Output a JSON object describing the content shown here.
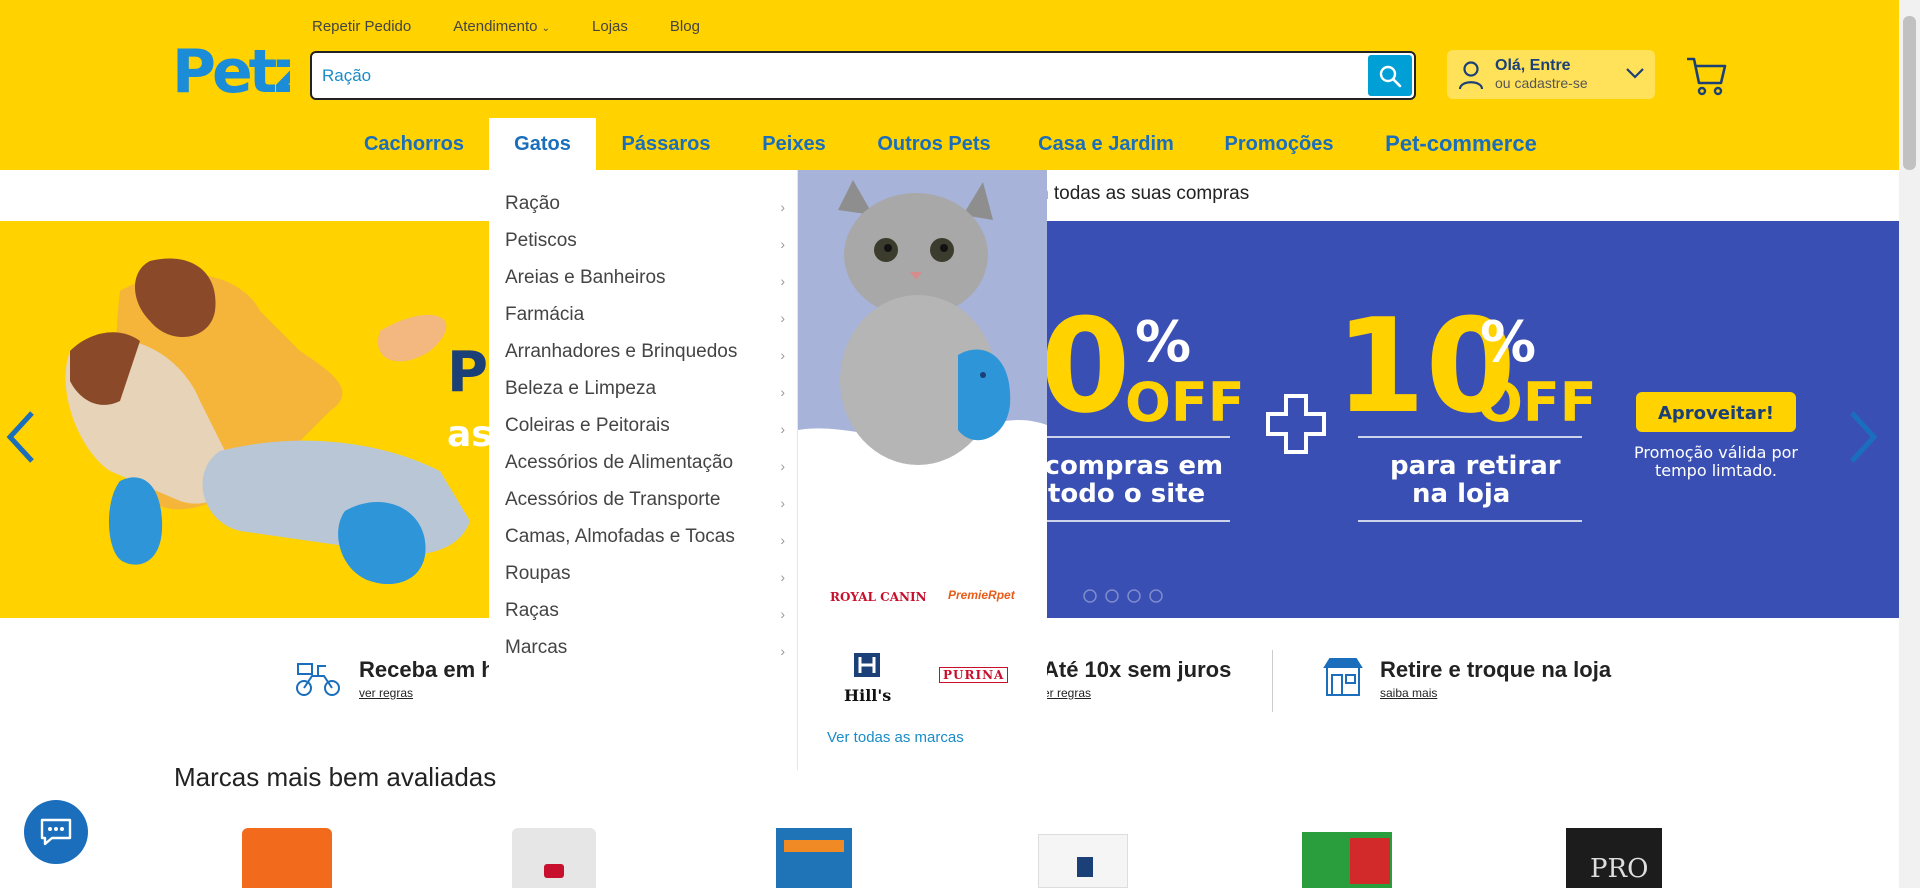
{
  "top_links": [
    "Repetir Pedido",
    "Atendimento",
    "Lojas",
    "Blog"
  ],
  "logo_text": "Petz",
  "search": {
    "value": "Ração",
    "placeholder": ""
  },
  "account": {
    "line1": "Olá, Entre",
    "line2": "ou cadastre-se"
  },
  "categories": [
    "Cachorros",
    "Gatos",
    "Pássaros",
    "Peixes",
    "Outros Pets",
    "Casa e Jardim",
    "Promoções",
    "Pet-commerce"
  ],
  "active_category": "Gatos",
  "promo_strip": "n todas as suas compras",
  "hero": {
    "left_text1": "P",
    "left_text2": "as",
    "offer1_big": "0",
    "offer1_pct": "%",
    "offer1_off": "OFF",
    "offer1_sub1": "s compras em",
    "offer1_sub2": "todo o site",
    "offer2_big": "10",
    "offer2_pct": "%",
    "offer2_off": "OFF",
    "offer2_sub1": "para retirar",
    "offer2_sub2": "na loja",
    "button": "Aproveitar!",
    "note1": "Promoção válida por",
    "note2": "tempo limtado."
  },
  "dropdown": {
    "items": [
      "Ração",
      "Petiscos",
      "Areias e Banheiros",
      "Farmácia",
      "Arranhadores e Brinquedos",
      "Beleza e Limpeza",
      "Coleiras e Peitorais",
      "Acessórios de Alimentação",
      "Acessórios de Transporte",
      "Camas, Almofadas e Tocas",
      "Roupas",
      "Raças",
      "Marcas"
    ],
    "brands": [
      "ROYAL CANIN",
      "PremieRpet",
      "Hill's",
      "PURINA"
    ],
    "see_all": "Ver todas as marcas"
  },
  "benefits": [
    {
      "title": "Receba em h",
      "link": "ver regras"
    },
    {
      "title": "Até 10x sem juros",
      "link": "er regras"
    },
    {
      "title": "Retire e troque na loja",
      "link": "saiba mais"
    }
  ],
  "section_title": "Marcas mais bem avaliadas",
  "colors": {
    "brand_yellow": "#ffd200",
    "brand_blue": "#1a6ebc",
    "search_blue": "#00a0d6",
    "hero_blue": "#3a4fb3"
  }
}
